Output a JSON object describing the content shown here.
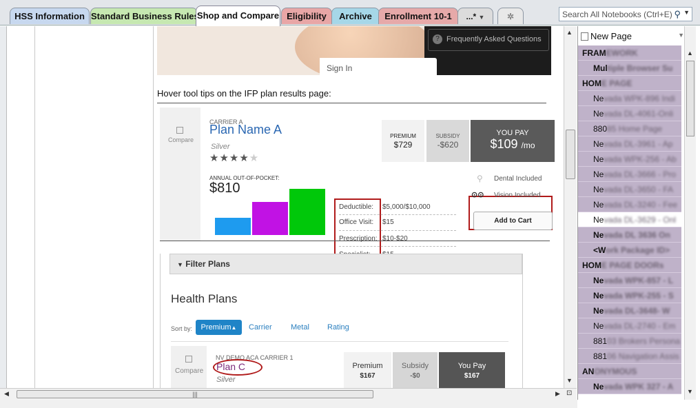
{
  "tabs": [
    {
      "label": "HSS Information",
      "color": "#c7d8ef"
    },
    {
      "label": "Standard Business Rules",
      "color": "#c6e8b1"
    },
    {
      "label": "Shop and Compare",
      "color": "#ffffff"
    },
    {
      "label": "Eligibility",
      "color": "#e8a6a6"
    },
    {
      "label": "Archive",
      "color": "#a6d7e8"
    },
    {
      "label": "Enrollment 10-1",
      "color": "#e6a9a9"
    },
    {
      "label": "...*",
      "color": "#dcdcdc"
    }
  ],
  "search": {
    "placeholder": "Search All Notebooks (Ctrl+E)"
  },
  "pages_panel": {
    "new_page": "New Page",
    "items": [
      {
        "vis": "FRAM",
        "blur": "EWORK",
        "style": "h"
      },
      {
        "vis": "Mul",
        "blur": "tiple Browser Su",
        "style": "b"
      },
      {
        "vis": "HOM",
        "blur": "E PAGE",
        "style": "h"
      },
      {
        "vis": "Ne",
        "blur": "vada WPK-896 Indi",
        "style": "n"
      },
      {
        "vis": "Ne",
        "blur": "vada DL-4061-Onli",
        "style": "n"
      },
      {
        "vis": "880",
        "blur": "85 Home Page",
        "style": "n"
      },
      {
        "vis": "Ne",
        "blur": "vada DL-3961 - Ap",
        "style": "n"
      },
      {
        "vis": "Ne",
        "blur": "vada WPK-256 - Ab",
        "style": "n"
      },
      {
        "vis": "Ne",
        "blur": "vada DL-3666 - Pro",
        "style": "n"
      },
      {
        "vis": "Ne",
        "blur": "vada DL-3650 - FA",
        "style": "n"
      },
      {
        "vis": "Ne",
        "blur": "vada DL-3240 - Fee",
        "style": "n"
      },
      {
        "vis": "Ne",
        "blur": "vada DL-3629 - Onl",
        "style": "n",
        "selected": true
      },
      {
        "vis": "Ne",
        "blur": "vada DL 3636 On",
        "style": "b"
      },
      {
        "vis": "<W",
        "blur": "ork Package ID>",
        "style": "b"
      },
      {
        "vis": "HOM",
        "blur": "E PAGE DOORs",
        "style": "h"
      },
      {
        "vis": "Ne",
        "blur": "vada WPK-857 - L",
        "style": "b"
      },
      {
        "vis": "Ne",
        "blur": "vada WPK-255 - S",
        "style": "b"
      },
      {
        "vis": "Ne",
        "blur": "vada DL-3648- W",
        "style": "b"
      },
      {
        "vis": "Ne",
        "blur": "vada DL-2740 - Em",
        "style": "n"
      },
      {
        "vis": "881",
        "blur": "03 Brokers Persona",
        "style": "n"
      },
      {
        "vis": "881",
        "blur": "06 Navigation Assis",
        "style": "n"
      },
      {
        "vis": "AN",
        "blur": "ONYMOUS",
        "style": "h"
      },
      {
        "vis": "Ne",
        "blur": "vada WPK 327 - A",
        "style": "b"
      }
    ]
  },
  "banner": {
    "faq": "Frequently Asked Questions",
    "sign_in": "Sign In"
  },
  "caption": "Hover tool tips on the IFP plan results page:",
  "plan_a": {
    "compare": "Compare",
    "carrier": "CARRIER A",
    "name": "Plan Name A",
    "metal": "Silver",
    "stars_on": "★★★★",
    "stars_off": "★",
    "aoop_label": "ANNUAL OUT-OF-POCKET:",
    "aoop_value": "$810",
    "bars": [
      {
        "color": "#1e9bef",
        "value": 31
      },
      {
        "color": "#c112e4",
        "value": 59
      },
      {
        "color": "#00c80a",
        "value": 82
      }
    ],
    "details": [
      {
        "label": "Deductible:",
        "value": "$5,000/$10,000"
      },
      {
        "label": "Office Visit:",
        "value": "$15"
      },
      {
        "label": "Prescription:",
        "value": "$10-$20"
      },
      {
        "label": "Specialist:",
        "value": "$15"
      }
    ],
    "premium_label": "PREMIUM",
    "premium_value": "$729",
    "subsidy_label": "SUBSIDY",
    "subsidy_value": "-$620",
    "you_pay_label": "YOU PAY",
    "you_pay_value": "$109",
    "you_pay_unit": "/mo",
    "dental": "Dental Included",
    "vision": "Vision Included",
    "add_to_cart": "Add to Cart"
  },
  "results": {
    "filter": "Filter Plans",
    "heading": "Health Plans",
    "sort_by": "Sort by:",
    "sort_premium": "Premium",
    "sort_options": [
      "Carrier",
      "Metal",
      "Rating"
    ],
    "compare": "Compare",
    "carrier": "NV DEMO ACA CARRIER 1",
    "plan": "Plan C",
    "metal": "Silver",
    "premium_label": "Premium",
    "premium_value": "$167",
    "subsidy_label": "Subsidy",
    "subsidy_value": "-$0",
    "you_pay_label": "You Pay",
    "you_pay_value": "$167"
  }
}
